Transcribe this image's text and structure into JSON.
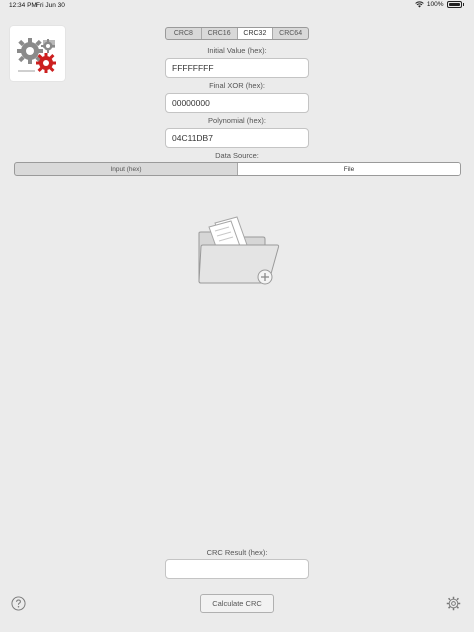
{
  "status": {
    "time": "12:34 PM",
    "date": "Fri Jun 30",
    "battery": "100%",
    "icons": [
      "wifi-icon",
      "battery-icon"
    ]
  },
  "app": {
    "icon": "gears-app-icon"
  },
  "crc_tabs": [
    {
      "label": "CRC8",
      "active": false
    },
    {
      "label": "CRC16",
      "active": false
    },
    {
      "label": "CRC32",
      "active": true
    },
    {
      "label": "CRC64",
      "active": false
    }
  ],
  "fields": {
    "initial_value": {
      "label": "Initial Value (hex):",
      "value": "FFFFFFFF"
    },
    "final_xor": {
      "label": "Final XOR (hex):",
      "value": "00000000"
    },
    "polynomial": {
      "label": "Polynomial (hex):",
      "value": "04C11DB7"
    }
  },
  "data_source": {
    "label": "Data Source:",
    "options": [
      {
        "label": "Input (hex)",
        "active": false
      },
      {
        "label": "File",
        "active": true
      }
    ]
  },
  "file_picker": {
    "icon": "folder-add-file-icon"
  },
  "result": {
    "label": "CRC Result (hex):",
    "value": ""
  },
  "calculate_button": "Calculate CRC",
  "footer_icons": [
    "help-icon",
    "gear-icon"
  ],
  "colors": {
    "background": "#ebebeb",
    "field_bg": "#ffffff",
    "gear_red": "#cc1f1f",
    "gear_gray": "#8a8a8a"
  }
}
